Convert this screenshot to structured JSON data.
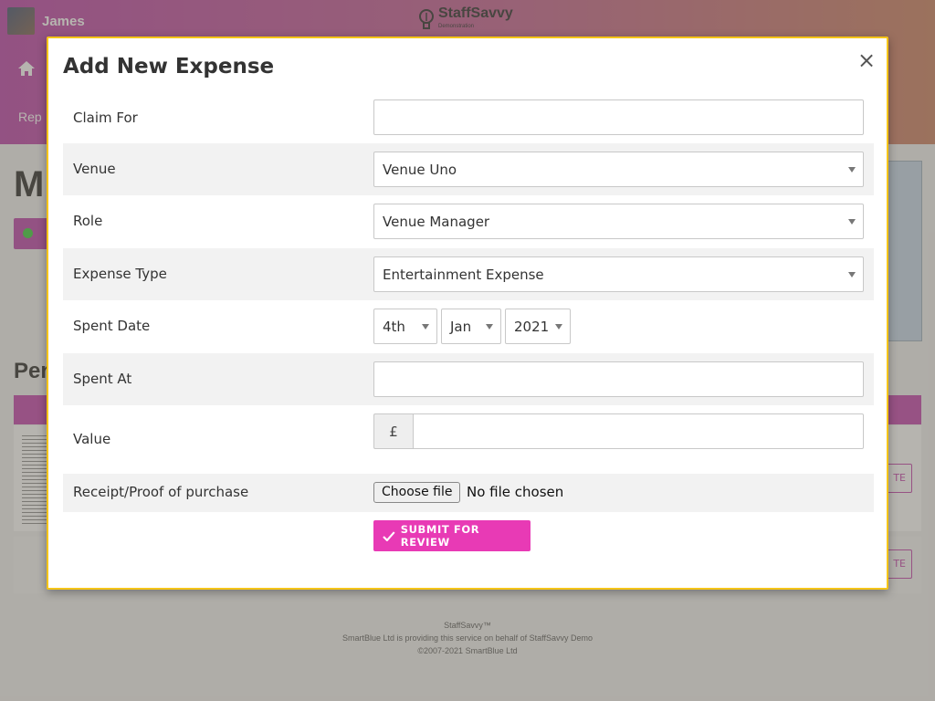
{
  "header": {
    "user_name": "James",
    "brand_name": "StaffSavvy",
    "brand_sub": "Demonstration",
    "home_icon": "home-icon"
  },
  "background": {
    "nav_partial": "Rep",
    "page_heading_partial": "M",
    "section_heading_partial": "Per",
    "row_button_partial": "TE"
  },
  "modal": {
    "title": "Add New Expense",
    "close_symbol": "×",
    "fields": {
      "claim_for": {
        "label": "Claim For",
        "value": ""
      },
      "venue": {
        "label": "Venue",
        "value": "Venue Uno"
      },
      "role": {
        "label": "Role",
        "value": "Venue Manager"
      },
      "expense_type": {
        "label": "Expense Type",
        "value": "Entertainment Expense"
      },
      "spent_date": {
        "label": "Spent Date",
        "day": "4th",
        "month": "Jan",
        "year": "2021"
      },
      "spent_at": {
        "label": "Spent At",
        "value": ""
      },
      "value": {
        "label": "Value",
        "currency_symbol": "£",
        "value": ""
      },
      "receipt": {
        "label": "Receipt/Proof of purchase",
        "button_label": "Choose file",
        "status": "No file chosen"
      }
    },
    "submit_label": "SUBMIT FOR REVIEW"
  },
  "footer": {
    "line1": "StaffSavvy™",
    "line2": "SmartBlue Ltd is providing this service on behalf of StaffSavvy Demo",
    "line3": "©2007-2021 SmartBlue Ltd"
  },
  "colors": {
    "accent": "#e83ab5",
    "modal_border": "#f5c518",
    "header_gradient_start": "#b93aa6",
    "header_gradient_end": "#c97a5a"
  }
}
